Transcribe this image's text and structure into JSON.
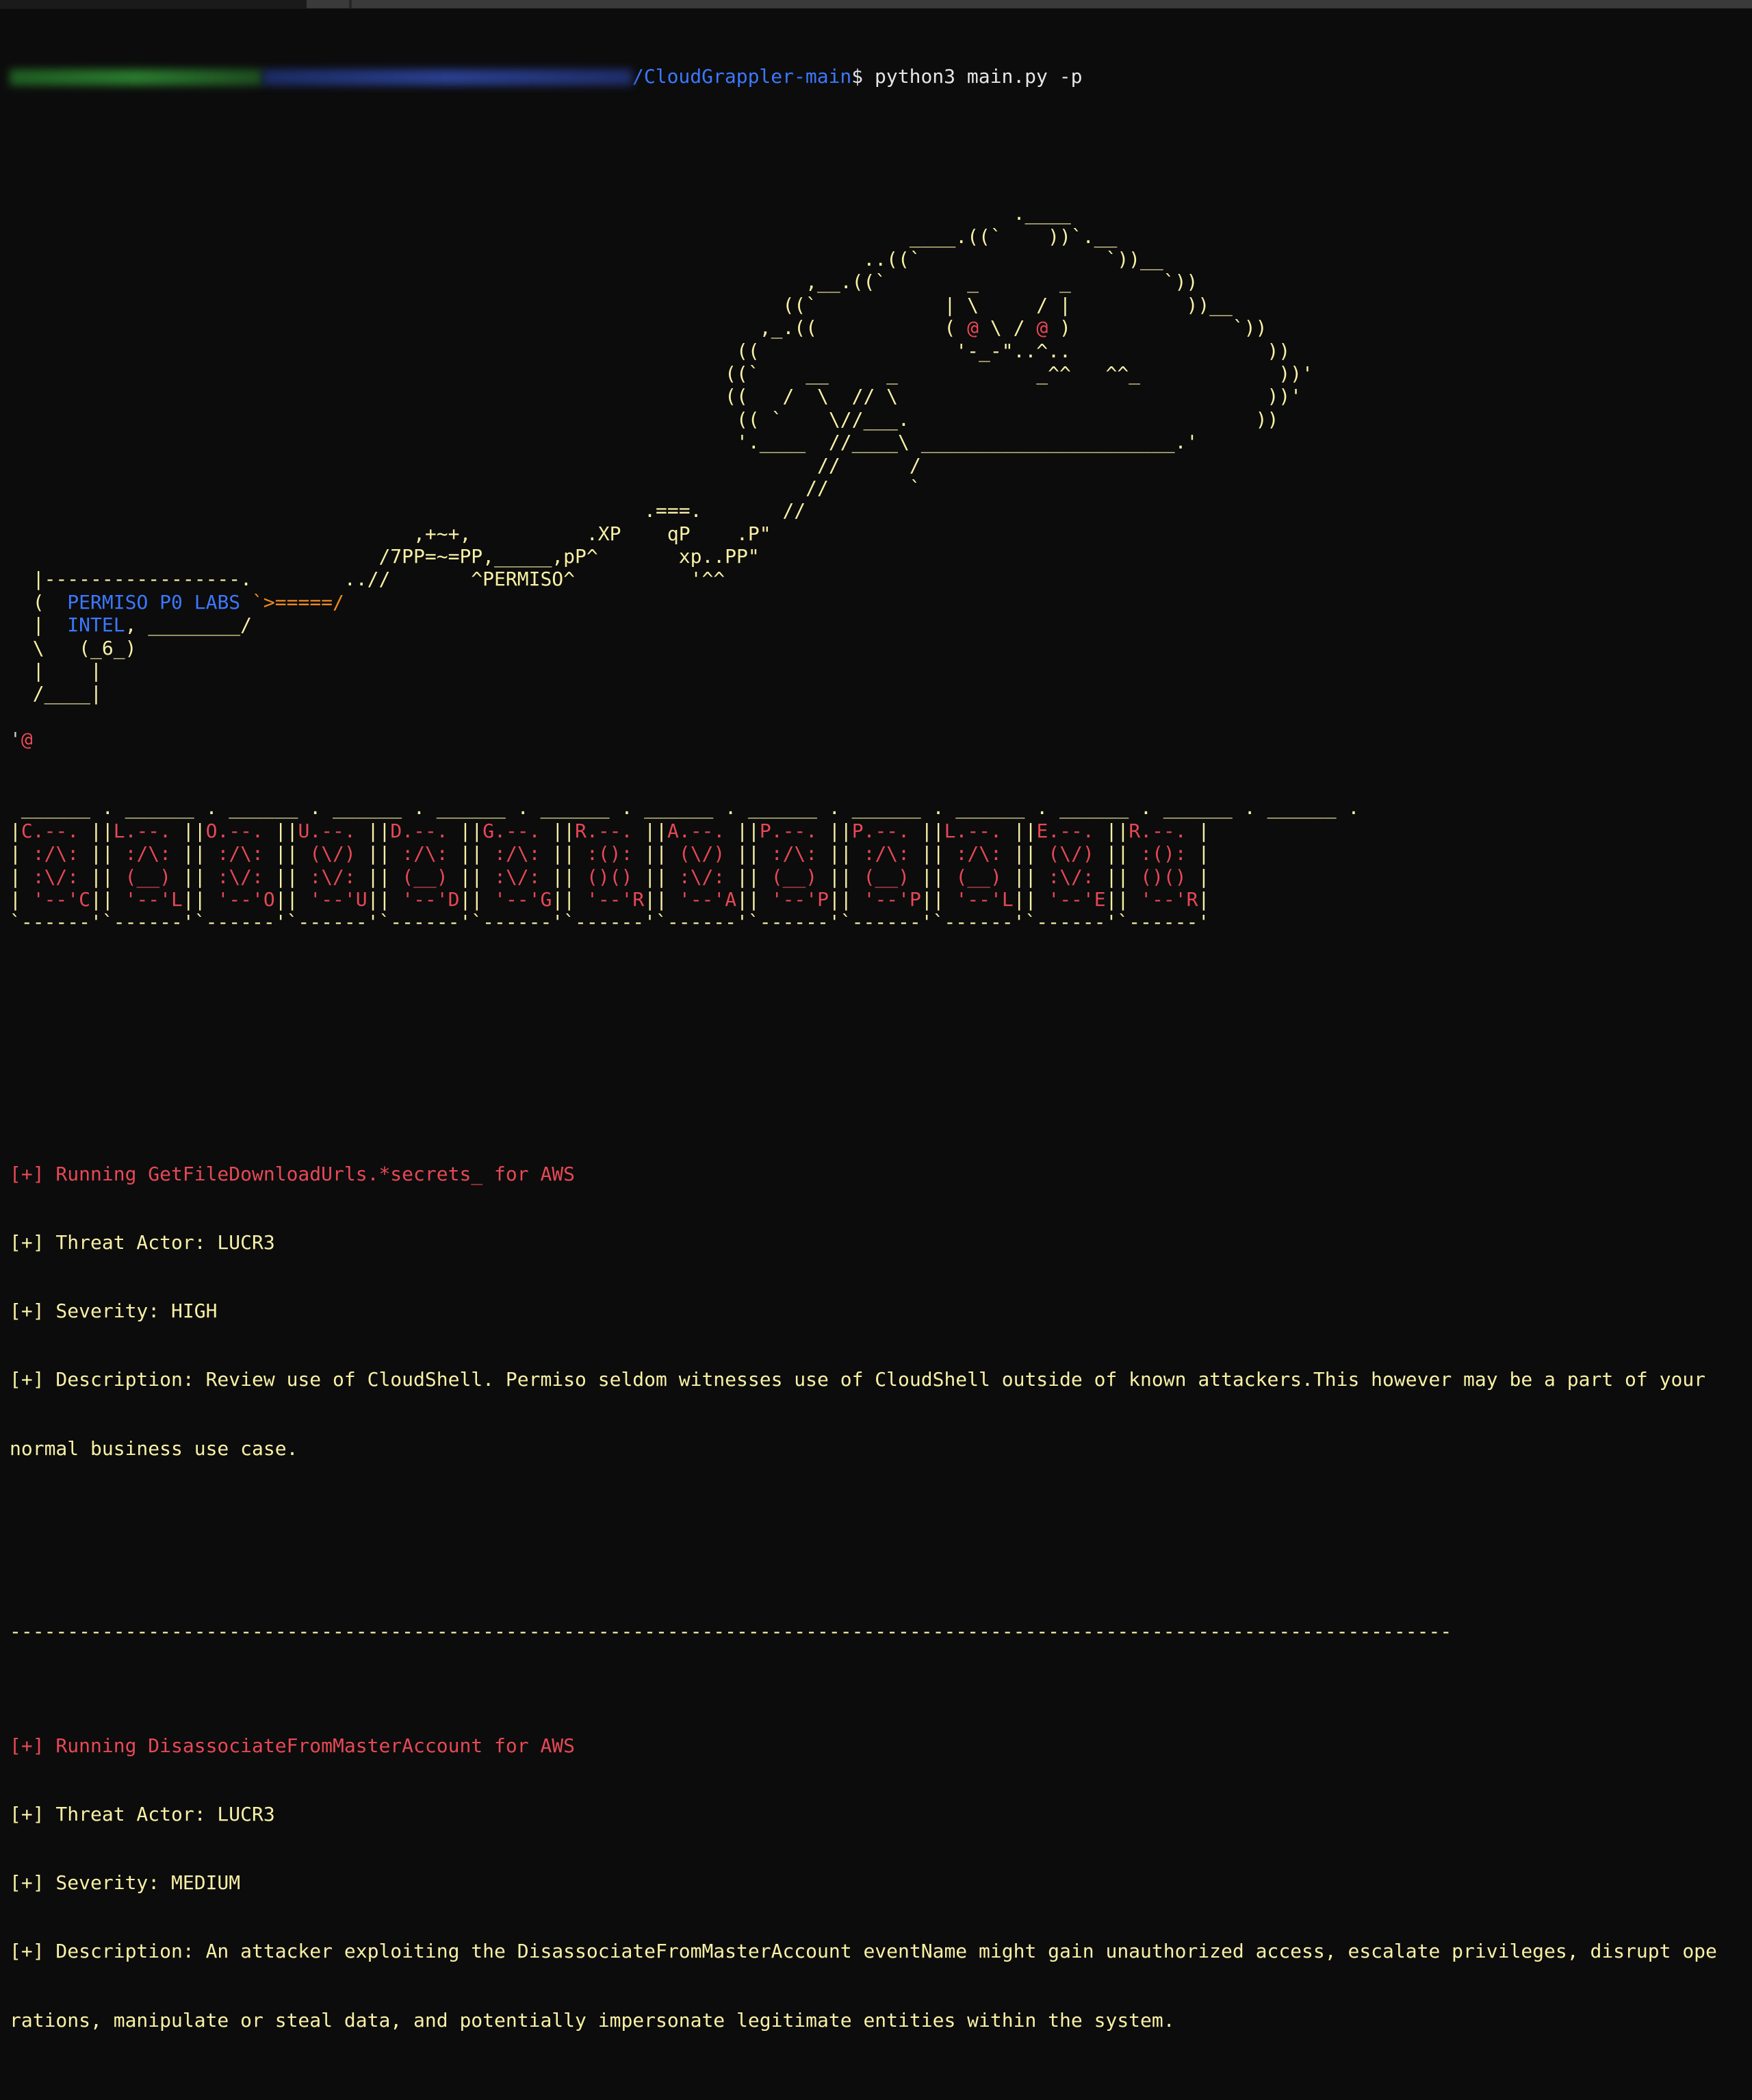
{
  "prompt": {
    "path": "/CloudGrappler-main",
    "symbol": "$ ",
    "command": "python3 main.py -p"
  },
  "banner": {
    "art_lines": [
      "                                                                                       .____",
      "                                                                              ____.((`    ))`.__",
      "                                                                          ..((`                `))__",
      "                                                                     ,__.((`       _       _        `))",
      "                                                                   ((`           | \\     / |          ))__",
      "                                                                 ,_.((           ( @ \\ / @ )              `))",
      "                                                               ((                 '-_-\"..^..                 ))",
      "                                                              ((`    __     _            _^^   ^^_            ))'",
      "                                                              ((   /  \\  // \\                                ))'",
      "                                                               (( `    \\//___.                              ))",
      "                                                               '.____  //____\\ ______________________.'",
      "                                                                      //      /",
      "                                                                     //       `",
      "                                                       .===.       //",
      "                                   ,+~+,          .XP    qP    .P\"",
      "                                /7PP=~=PP,_____,pP^       xp..PP\"",
      "  |-----------------.        ..//       ^PERMISO^          '^^",
      "  (  PERMISO P0 LABS `>=====/",
      "  |  INTEL, ________/",
      "  \\   (_6_)",
      "  |    |",
      "  /____|",
      "",
      "'@"
    ],
    "cards_top": " ______ . ______ . ______ . ______ . ______ . ______ . ______ . ______ . ______ . ______ . ______ . ______ . ______ .",
    "cards_letters": [
      "C",
      "L",
      "O",
      "U",
      "D",
      "G",
      "R",
      "A",
      "P",
      "P",
      "L",
      "E",
      "R"
    ],
    "cards_suits": [
      [
        " :/\\: ",
        " :\\/: "
      ],
      [
        " :/\\: ",
        " (__) "
      ],
      [
        " :/\\: ",
        " :\\/: "
      ],
      [
        " (\\/) ",
        " :\\/: "
      ],
      [
        " :/\\: ",
        " (__) "
      ],
      [
        " :/\\: ",
        " :\\/: "
      ],
      [
        " :(): ",
        " ()() "
      ],
      [
        " (\\/) ",
        " :\\/: "
      ],
      [
        " :/\\: ",
        " (__) "
      ],
      [
        " :/\\: ",
        " (__) "
      ],
      [
        " :/\\: ",
        " (__) "
      ],
      [
        " (\\/) ",
        " :\\/: "
      ],
      [
        " :(): ",
        " ()() "
      ]
    ]
  },
  "output": {
    "blocks": [
      {
        "running": "[+] Running GetFileDownloadUrls.*secrets_ for AWS",
        "actor": "[+] Threat Actor: LUCR3",
        "severity": "[+] Severity: HIGH",
        "description_1": "[+] Description: Review use of CloudShell. Permiso seldom witnesses use of CloudShell outside of known attackers.This however may be a part of your",
        "description_2": "normal business use case."
      },
      {
        "running": "[+] Running DisassociateFromMasterAccount for AWS",
        "actor": "[+] Threat Actor: LUCR3",
        "severity": "[+] Severity: MEDIUM",
        "description_1": "[+] Description: An attacker exploiting the DisassociateFromMasterAccount eventName might gain unauthorized access, escalate privileges, disrupt ope",
        "description_2": "rations, manipulate or steal data, and potentially impersonate legitimate entities within the system."
      }
    ],
    "separator": "-----------------------------------------------------------------------------------------------------------------------------"
  },
  "colors": {
    "background": "#0c0c0c",
    "path_blue": "#3b78ff",
    "art_yellow": "#f9f1a5",
    "alert_red": "#e74856",
    "arrow_orange": "#f08a24"
  }
}
